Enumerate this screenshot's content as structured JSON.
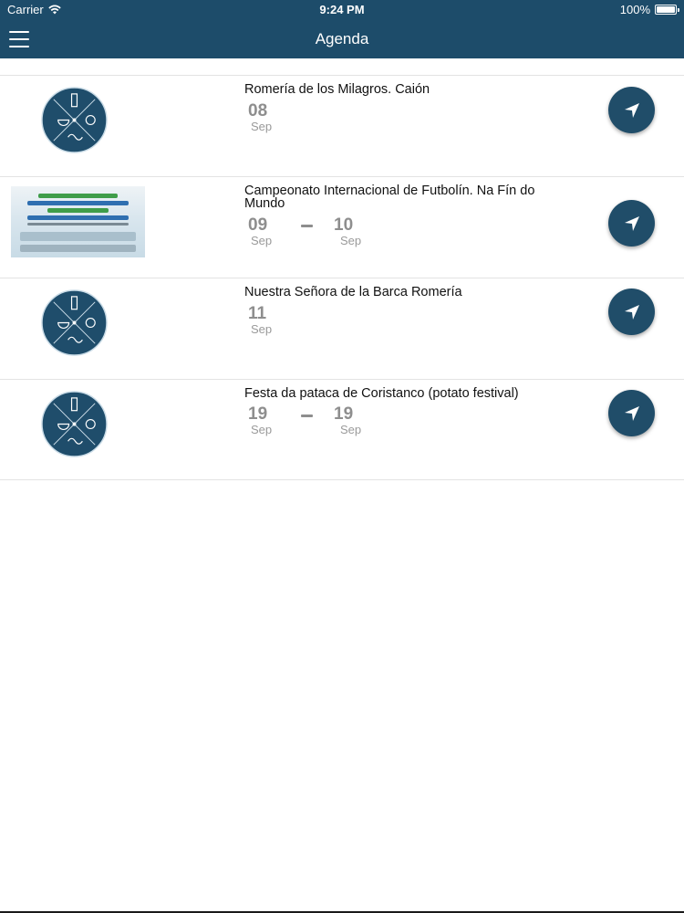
{
  "status_bar": {
    "carrier": "Carrier",
    "time": "9:24 PM",
    "battery": "100%"
  },
  "header": {
    "title": "Agenda",
    "menu_icon": "hamburger-menu-icon"
  },
  "events": [
    {
      "title": "Romería de los Milagros. Caión",
      "thumbnail": "logo",
      "start": {
        "day": "08",
        "month": "Sep"
      },
      "end": null
    },
    {
      "title": "Campeonato Internacional de Futbolín. Na Fín do Mundo",
      "thumbnail": "poster",
      "start": {
        "day": "09",
        "month": "Sep"
      },
      "end": {
        "day": "10",
        "month": "Sep"
      }
    },
    {
      "title": "Nuestra Señora de la Barca Romería",
      "thumbnail": "logo",
      "start": {
        "day": "11",
        "month": "Sep"
      },
      "end": null
    },
    {
      "title": "Festa da pataca de Coristanco (potato festival)",
      "thumbnail": "logo",
      "start": {
        "day": "19",
        "month": "Sep"
      },
      "end": {
        "day": "19",
        "month": "Sep"
      }
    }
  ],
  "colors": {
    "brand": "#1d4c6a",
    "date_text": "#8e8e8e"
  },
  "icons": {
    "navigate": "navigation-arrow-icon",
    "logo": "lighthouse-shell-wave-logo-icon"
  }
}
